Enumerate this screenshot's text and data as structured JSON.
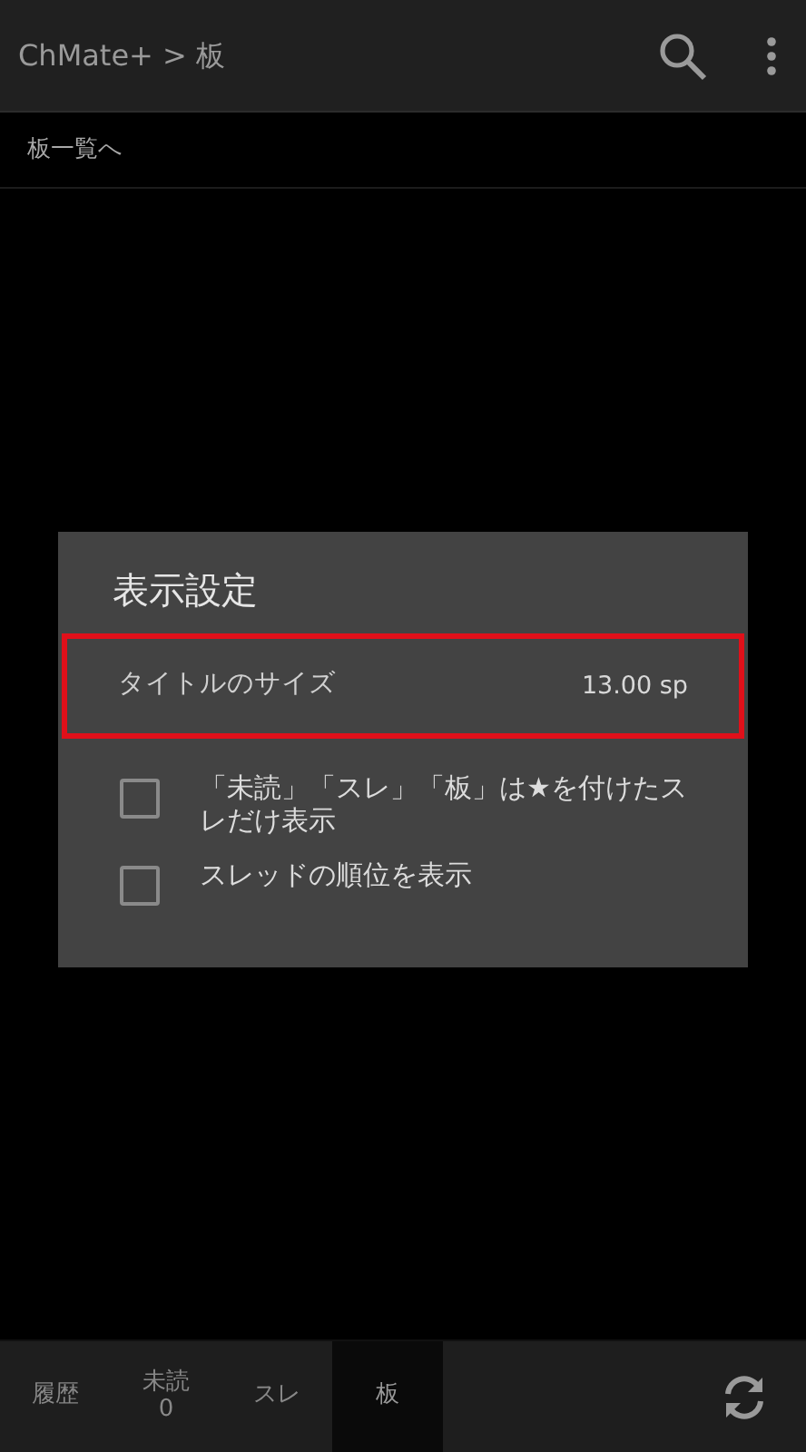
{
  "app_bar": {
    "title": "ChMate+ > 板"
  },
  "subheader": {
    "link": "板一覧へ"
  },
  "dialog": {
    "title": "表示設定",
    "items": [
      {
        "kind": "value",
        "label": "タイトルのサイズ",
        "value": "13.00 sp",
        "highlighted": true
      },
      {
        "kind": "checkbox",
        "label": "「未読」「スレ」「板」は★を付けたスレだけ表示",
        "checked": false
      },
      {
        "kind": "checkbox",
        "label": "スレッドの順位を表示",
        "checked": false
      }
    ]
  },
  "bottom_tabs": [
    {
      "label": "履歴",
      "selected": false
    },
    {
      "label": "未読",
      "count": "0",
      "selected": false
    },
    {
      "label": "スレ",
      "selected": false
    },
    {
      "label": "板",
      "selected": true
    }
  ]
}
